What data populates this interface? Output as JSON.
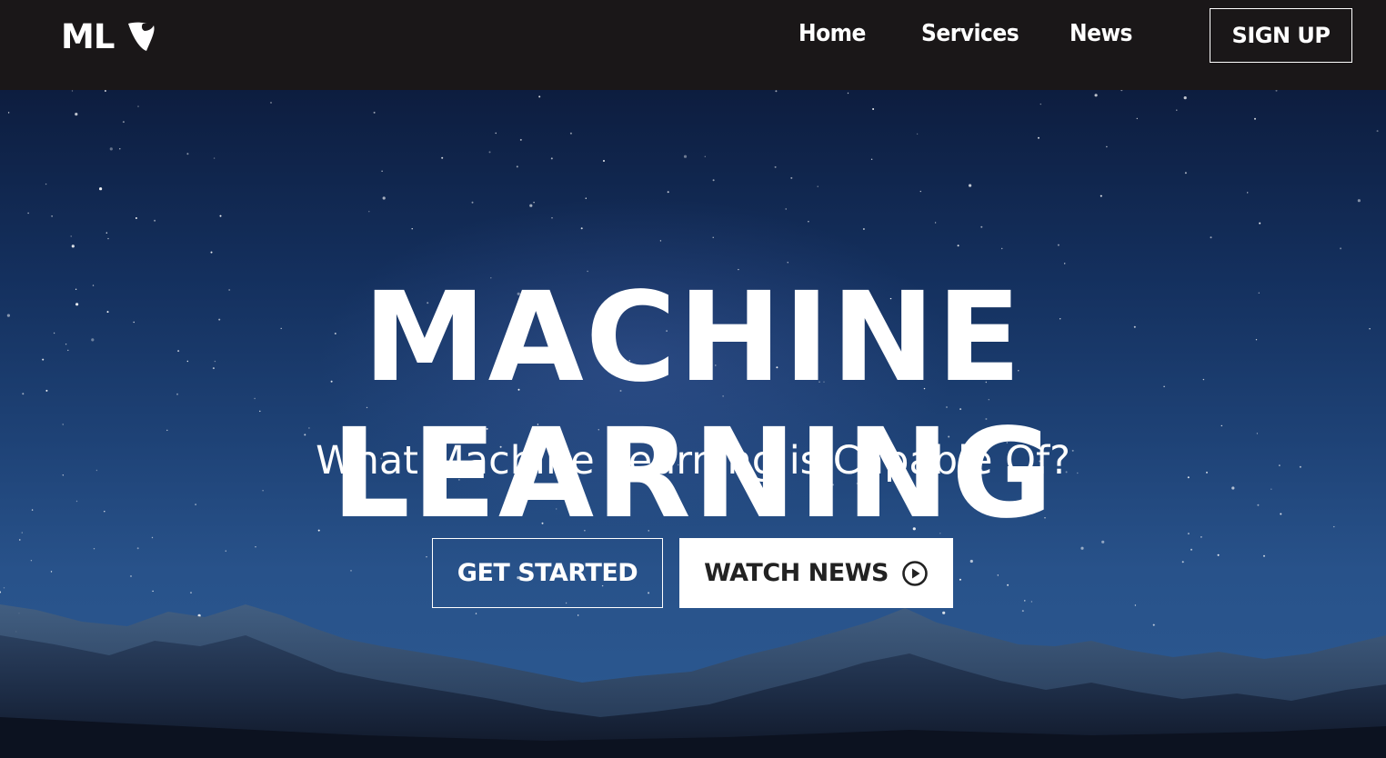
{
  "header": {
    "logo_text": "ML",
    "nav": {
      "home": "Home",
      "services": "Services",
      "news": "News"
    },
    "signup_label": "SIGN UP"
  },
  "hero": {
    "title": "MACHINE LEARNING",
    "subtitle": "What Machine Learning is Capable Of?",
    "get_started_label": "GET STARTED",
    "watch_news_label": "WATCH NEWS"
  },
  "icons": {
    "logo_mark": "typo3-logo-icon",
    "play": "play-circle-icon"
  },
  "colors": {
    "header_bg": "#1a1718",
    "sky_top": "#0d1d3f",
    "sky_bottom": "#2c5a92",
    "text": "#ffffff",
    "button_dark_text": "#222222"
  }
}
